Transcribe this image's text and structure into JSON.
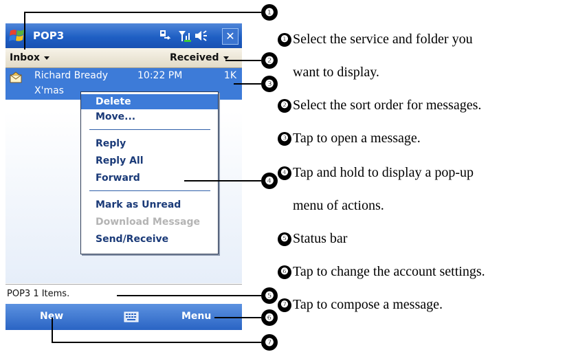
{
  "titlebar": {
    "app_title": "POP3",
    "close_glyph": "✕"
  },
  "menubar": {
    "folder": "Inbox",
    "sort": "Received"
  },
  "message": {
    "sender": "Richard Bready",
    "time": "10:22 PM",
    "size": "1K",
    "subject": "X'mas"
  },
  "popup": {
    "items": [
      "Delete",
      "Move...",
      "Reply",
      "Reply All",
      "Forward",
      "Mark as Unread",
      "Download Message",
      "Send/Receive"
    ]
  },
  "status": {
    "text": "POP3  1 Items."
  },
  "softkeys": {
    "left": "New",
    "right": "Menu"
  },
  "callouts": [
    "❶",
    "❷",
    "❸",
    "❹",
    "❺",
    "❻",
    "❼"
  ],
  "descriptions": [
    "Select the service and folder you",
    "want to display.",
    "Select the sort order for messages.",
    "Tap to open a message.",
    "Tap and hold to display a pop-up",
    "menu of actions.",
    "Status bar",
    "Tap to change the account settings.",
    "Tap to compose a message."
  ],
  "colors": {
    "titlebar": "#1f5fc4",
    "selection": "#3d7bd8",
    "menu_text": "#1a3a78"
  },
  "icons": [
    "windows-flag-icon",
    "sync-icon",
    "signal-icon",
    "speaker-icon",
    "close-icon",
    "envelope-icon",
    "keyboard-icon"
  ]
}
